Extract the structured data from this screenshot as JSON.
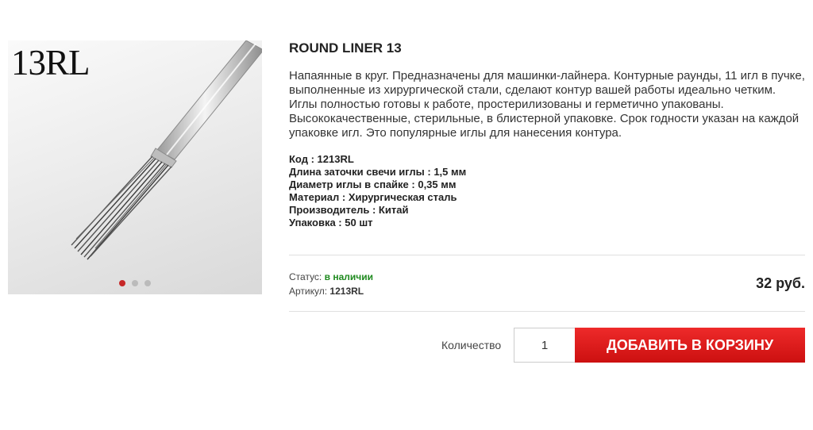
{
  "product": {
    "image_label": "13RL",
    "image_alt": "needle-image",
    "gallery_dots": [
      {
        "active": true
      },
      {
        "active": false
      },
      {
        "active": false
      }
    ],
    "title": "ROUND LINER 13",
    "description": "Напаянные в круг. Предназначены для машинки-лайнера. Контурные раунды, 11 игл в пучке, выполненные из хирургической стали, сделают контур вашей работы идеально четким. Иглы полностью готовы к работе, простерилизованы и герметично упакованы. Высококачественные, стерильные, в блистерной упаковке. Срок годности указан на каждой упаковке игл. Это популярные иглы для нанесения контура.",
    "specs": [
      {
        "label": "Код",
        "value": "1213RL"
      },
      {
        "label": "Длина заточки свечи иглы",
        "value": "1,5 мм"
      },
      {
        "label": "Диаметр иглы в спайке",
        "value": "0,35 мм"
      },
      {
        "label": "Материал",
        "value": "Хирургическая сталь"
      },
      {
        "label": "Производитель",
        "value": "Китай"
      },
      {
        "label": "Упаковка",
        "value": "50 шт"
      }
    ],
    "status_label": "Статус:",
    "status_value": "в наличии",
    "sku_label": "Артикул:",
    "sku_value": "1213RL",
    "price": "32 руб.",
    "quantity_label": "Количество",
    "quantity_value": "1",
    "add_to_cart_label": "ДОБАВИТЬ В КОРЗИНУ"
  },
  "colors": {
    "accent_red": "#cc1010",
    "status_green": "#1e8a1e",
    "active_dot": "#c62828"
  }
}
